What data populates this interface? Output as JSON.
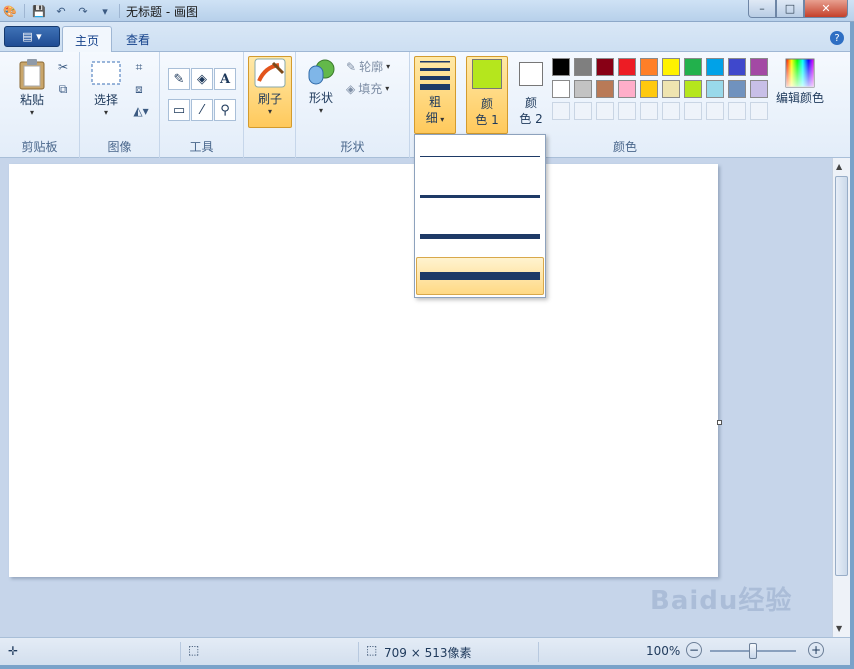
{
  "window": {
    "title": "无标题 - 画图",
    "controls": {
      "minimize": "–",
      "maximize": "□",
      "close": "✕"
    }
  },
  "tabs": [
    {
      "label": "主页",
      "active": true
    },
    {
      "label": "查看",
      "active": false
    }
  ],
  "help_glyph": "?",
  "ribbon": {
    "clipboard": {
      "group_label": "剪贴板",
      "paste_label": "粘贴"
    },
    "image": {
      "group_label": "图像",
      "select_label": "选择"
    },
    "tools": {
      "group_label": "工具",
      "text_glyph": "A"
    },
    "brushes": {
      "label": "刷子"
    },
    "shapes": {
      "group_label": "形状",
      "shapes_label": "形状",
      "outline_label": "轮廓",
      "fill_label": "填充"
    },
    "size": {
      "label_line1": "粗",
      "label_line2": "细"
    },
    "color1": {
      "label_line1": "颜",
      "label_line2": "色 1",
      "value": "#b5e61d"
    },
    "color2": {
      "label_line1": "颜",
      "label_line2": "色 2",
      "value": "#ffffff"
    },
    "colors": {
      "group_label": "颜色",
      "edit_label": "编辑颜色",
      "row1": [
        "#000000",
        "#7f7f7f",
        "#880015",
        "#ed1c24",
        "#ff7f27",
        "#fff200",
        "#22b14c",
        "#00a2e8",
        "#3f48cc",
        "#a349a4"
      ],
      "row2": [
        "#ffffff",
        "#c3c3c3",
        "#b97a57",
        "#ffaec9",
        "#ffc90e",
        "#efe4b0",
        "#b5e61d",
        "#99d9ea",
        "#7092be",
        "#c8bfe7"
      ]
    }
  },
  "size_dropdown": {
    "options": [
      {
        "thickness": 1,
        "selected": false
      },
      {
        "thickness": 3,
        "selected": false
      },
      {
        "thickness": 5,
        "selected": false
      },
      {
        "thickness": 8,
        "selected": true
      }
    ]
  },
  "statusbar": {
    "image_size": "709 × 513像素",
    "zoom": "100%",
    "zoom_out": "−",
    "zoom_in": "+"
  },
  "watermark": "Baidu经验"
}
